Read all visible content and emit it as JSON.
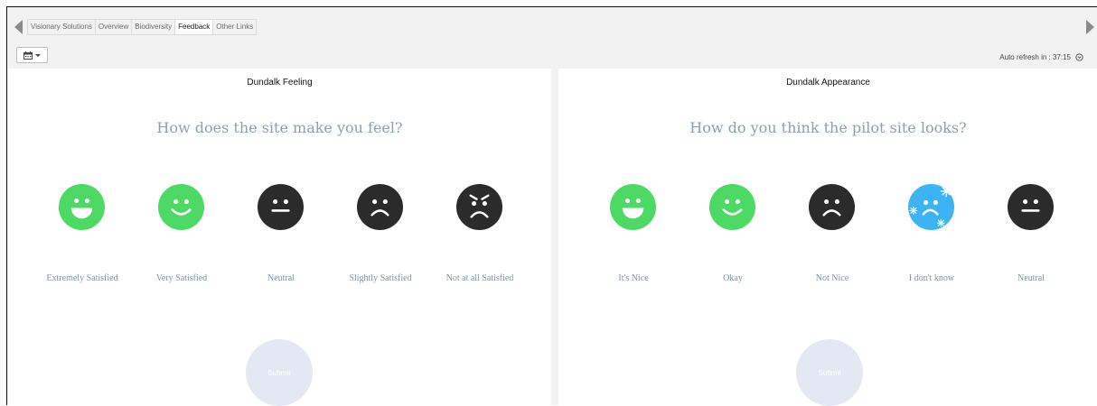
{
  "tabs": [
    {
      "label": "Visionary Solutions",
      "active": false
    },
    {
      "label": "Overview",
      "active": false
    },
    {
      "label": "Biodiversity",
      "active": false
    },
    {
      "label": "Feedback",
      "active": true
    },
    {
      "label": "Other Links",
      "active": false
    }
  ],
  "toolbar": {
    "auto_refresh_label": "Auto refresh in : 37:15"
  },
  "panels": [
    {
      "title": "Dundalk Feeling",
      "question": "How does the site make you feel?",
      "options": [
        {
          "label": "Extremely Satisfied",
          "icon": "grin-face-icon",
          "color": "#4cd964"
        },
        {
          "label": "Very Satisfied",
          "icon": "smile-face-icon",
          "color": "#4cd964"
        },
        {
          "label": "Neutral",
          "icon": "neutral-face-icon",
          "color": "#2b2b2b"
        },
        {
          "label": "Slightly Satisfied",
          "icon": "frown-face-icon",
          "color": "#2b2b2b"
        },
        {
          "label": "Not at all Satisfied",
          "icon": "angry-face-icon",
          "color": "#2b2b2b"
        }
      ],
      "submit_label": "Submit"
    },
    {
      "title": "Dundalk Appearance",
      "question": "How do you think the pilot site looks?",
      "options": [
        {
          "label": "It's Nice",
          "icon": "grin-face-icon",
          "color": "#4cd964"
        },
        {
          "label": "Okay",
          "icon": "smile-face-icon",
          "color": "#4cd964"
        },
        {
          "label": "Not Nice",
          "icon": "frown-face-icon",
          "color": "#2b2b2b"
        },
        {
          "label": "I don't know",
          "icon": "freezing-face-icon",
          "color": "#3bb3f5"
        },
        {
          "label": "Neutral",
          "icon": "neutral-face-icon",
          "color": "#2b2b2b"
        }
      ],
      "submit_label": "Submit"
    }
  ],
  "colors": {
    "positive": "#4cd964",
    "dark": "#2b2b2b",
    "freeze": "#3bb3f5",
    "question_text": "#8ca0b2",
    "submit_bg": "#e3e8f2"
  }
}
